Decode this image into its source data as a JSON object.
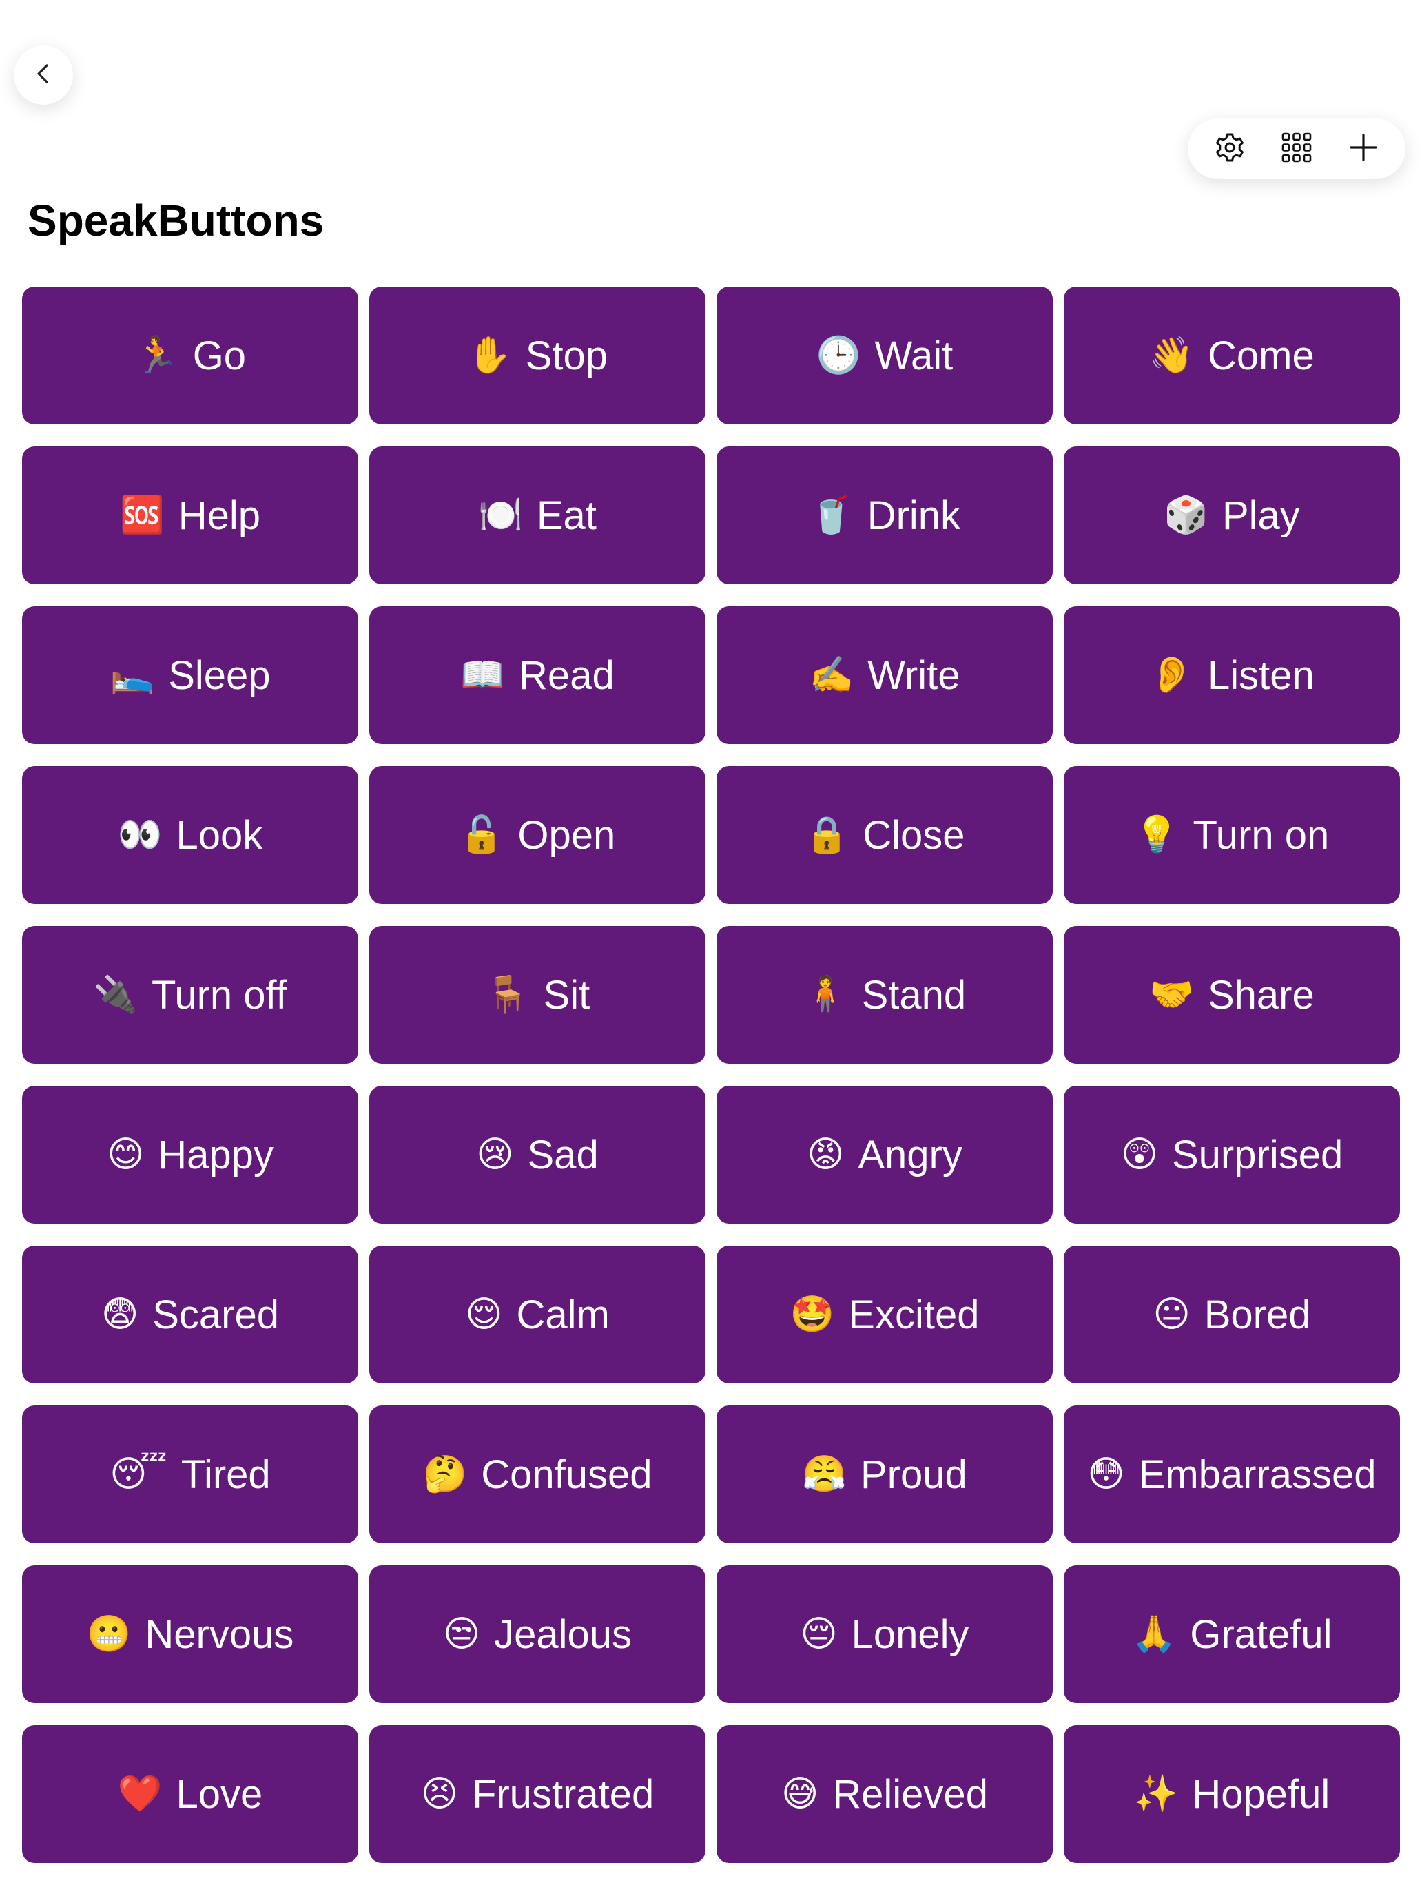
{
  "app": {
    "title": "SpeakButtons"
  },
  "colors": {
    "button_bg": "#611a7a",
    "button_text": "#ffffff",
    "page_bg": "#ffffff"
  },
  "toolbar": {
    "icons": [
      "gear-icon",
      "grid-icon",
      "plus-icon"
    ]
  },
  "nav": {
    "back_icon": "chevron-left-icon"
  },
  "buttons": [
    {
      "emoji": "🏃",
      "label": "Go"
    },
    {
      "emoji": "✋",
      "label": "Stop"
    },
    {
      "emoji": "🕒",
      "label": "Wait"
    },
    {
      "emoji": "👋",
      "label": "Come"
    },
    {
      "emoji": "🆘",
      "label": "Help"
    },
    {
      "emoji": "🍽️",
      "label": "Eat"
    },
    {
      "emoji": "🥤",
      "label": "Drink"
    },
    {
      "emoji": "🎲",
      "label": "Play"
    },
    {
      "emoji": "🛌",
      "label": "Sleep"
    },
    {
      "emoji": "📖",
      "label": "Read"
    },
    {
      "emoji": "✍️",
      "label": "Write"
    },
    {
      "emoji": "👂",
      "label": "Listen"
    },
    {
      "emoji": "👀",
      "label": "Look"
    },
    {
      "emoji": "🔓",
      "label": "Open"
    },
    {
      "emoji": "🔒",
      "label": "Close"
    },
    {
      "emoji": "💡",
      "label": "Turn on"
    },
    {
      "emoji": "🔌",
      "label": "Turn off"
    },
    {
      "emoji": "🪑",
      "label": "Sit"
    },
    {
      "emoji": "🧍",
      "label": "Stand"
    },
    {
      "emoji": "🤝",
      "label": "Share"
    },
    {
      "emoji": "😊",
      "label": "Happy"
    },
    {
      "emoji": "😢",
      "label": "Sad"
    },
    {
      "emoji": "😡",
      "label": "Angry"
    },
    {
      "emoji": "😲",
      "label": "Surprised"
    },
    {
      "emoji": "😨",
      "label": "Scared"
    },
    {
      "emoji": "😌",
      "label": "Calm"
    },
    {
      "emoji": "🤩",
      "label": "Excited"
    },
    {
      "emoji": "😐",
      "label": "Bored"
    },
    {
      "emoji": "😴",
      "label": "Tired"
    },
    {
      "emoji": "🤔",
      "label": "Confused"
    },
    {
      "emoji": "😤",
      "label": "Proud"
    },
    {
      "emoji": "😳",
      "label": "Embarrassed"
    },
    {
      "emoji": "😬",
      "label": "Nervous"
    },
    {
      "emoji": "😒",
      "label": "Jealous"
    },
    {
      "emoji": "😔",
      "label": "Lonely"
    },
    {
      "emoji": "🙏",
      "label": "Grateful"
    },
    {
      "emoji": "❤️",
      "label": "Love"
    },
    {
      "emoji": "😣",
      "label": "Frustrated"
    },
    {
      "emoji": "😅",
      "label": "Relieved"
    },
    {
      "emoji": "✨",
      "label": "Hopeful"
    }
  ]
}
